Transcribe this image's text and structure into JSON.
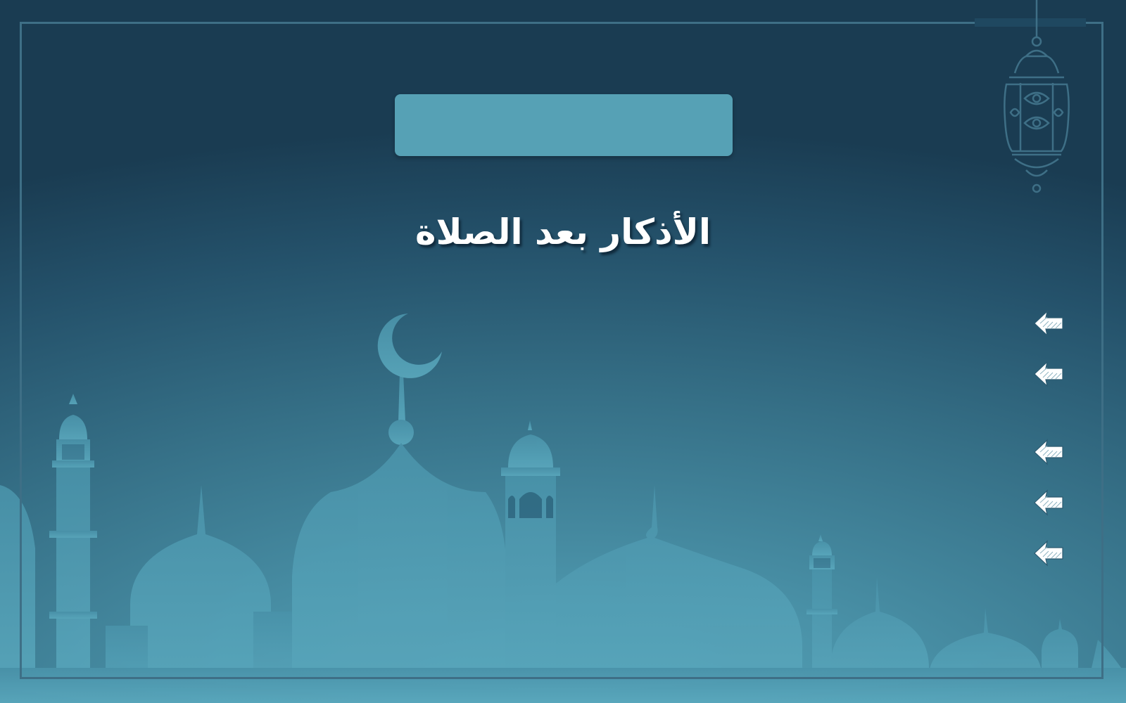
{
  "slide": {
    "title": "الأذكار بعد الصلاة",
    "title_box_label": ""
  },
  "nav_arrows": [
    {
      "icon": "back-arrow-icon"
    },
    {
      "icon": "back-arrow-icon"
    },
    {
      "icon": "back-arrow-icon"
    },
    {
      "icon": "back-arrow-icon"
    },
    {
      "icon": "back-arrow-icon"
    }
  ],
  "colors": {
    "background_dark": "#1a3c52",
    "background_light": "#5aa9bf",
    "title_box": "#56a1b5",
    "silhouette": "#4f9ab0",
    "frame": "#3e6f86",
    "text": "#ffffff"
  }
}
